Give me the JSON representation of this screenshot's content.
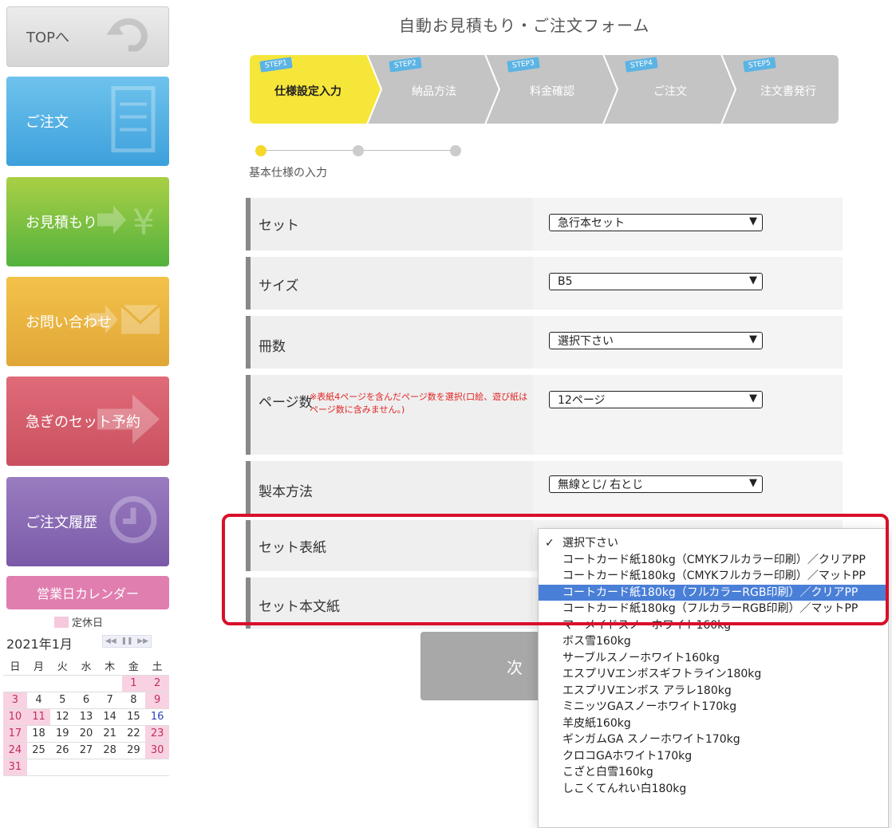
{
  "sidebar": {
    "top": "TOPへ",
    "order": "ご注文",
    "estimate": "お見積もり",
    "contact": "お問い合わせ",
    "rush": "急ぎのセット予約",
    "history": "ご注文履歴"
  },
  "calendar": {
    "title": "営業日カレンダー",
    "legend": "定休日",
    "month": "2021年1月",
    "weekdays": [
      "日",
      "月",
      "火",
      "水",
      "木",
      "金",
      "土"
    ],
    "weeks": [
      [
        "",
        "",
        "",
        "",
        "",
        "1",
        "2"
      ],
      [
        "3",
        "4",
        "5",
        "6",
        "7",
        "8",
        "9"
      ],
      [
        "10",
        "11",
        "12",
        "13",
        "14",
        "15",
        "16"
      ],
      [
        "17",
        "18",
        "19",
        "20",
        "21",
        "22",
        "23"
      ],
      [
        "24",
        "25",
        "26",
        "27",
        "28",
        "29",
        "30"
      ],
      [
        "31",
        "",
        "",
        "",
        "",
        "",
        ""
      ]
    ],
    "holidays": [
      "1",
      "2",
      "3",
      "9",
      "10",
      "11",
      "17",
      "23",
      "24",
      "30",
      "31"
    ],
    "blue_days": [
      "16"
    ]
  },
  "form": {
    "title": "自動お見積もり・ご注文フォーム",
    "steps": [
      {
        "tag": "STEP1",
        "label": "仕様設定入力"
      },
      {
        "tag": "STEP2",
        "label": "納品方法"
      },
      {
        "tag": "STEP3",
        "label": "料金確認"
      },
      {
        "tag": "STEP4",
        "label": "ご注文"
      },
      {
        "tag": "STEP5",
        "label": "注文書発行"
      }
    ],
    "progress_label": "基本仕様の入力",
    "rows": {
      "set": {
        "label": "セット",
        "value": "急行本セット"
      },
      "size": {
        "label": "サイズ",
        "value": "B5"
      },
      "copies": {
        "label": "冊数",
        "value": "選択下さい"
      },
      "pages": {
        "label": "ページ数",
        "value": "12ページ",
        "note": "※表紙4ページを含んだページ数を選択(口絵、遊び紙はページ数に含みません。)"
      },
      "binding": {
        "label": "製本方法",
        "value": "無線とじ/ 右とじ"
      },
      "cover": {
        "label": "セット表紙"
      },
      "body": {
        "label": "セット本文紙"
      }
    },
    "next_label": "次"
  },
  "dropdown": {
    "options": [
      "選択下さい",
      "コートカード紙180kg（CMYKフルカラー印刷）／クリアPP",
      "コートカード紙180kg（CMYKフルカラー印刷）／マットPP",
      "コートカード紙180kg（フルカラーRGB印刷）／クリアPP",
      "コートカード紙180kg（フルカラーRGB印刷）／マットPP",
      "マーメイドスノーホワイト160kg",
      "ボス雪160kg",
      "サーブルスノーホワイト160kg",
      "エスプリVエンボスギフトライン180kg",
      "エスプリVエンボス アラレ180kg",
      "ミニッツGAスノーホワイト170kg",
      "羊皮紙160kg",
      "ギンガムGA スノーホワイト170kg",
      "クロコGAホワイト170kg",
      "こざと白雪160kg",
      "しこくてんれい白180kg"
    ],
    "checked_index": 0,
    "highlighted_index": 3
  },
  "colors": {
    "active_step": "#f7e63a",
    "inactive_step": "#c4c4c4",
    "highlight_border": "#d8102a",
    "selected_option": "#4a7fd7"
  }
}
